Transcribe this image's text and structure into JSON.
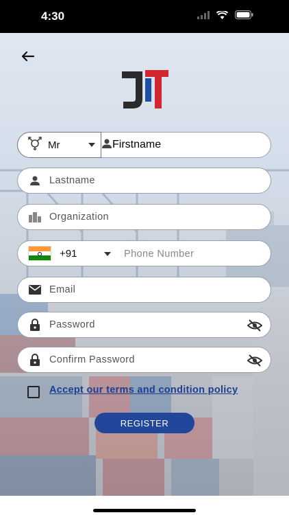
{
  "status_bar": {
    "time": "4:30"
  },
  "form": {
    "title_value": "Mr",
    "firstname_placeholder": "Firstname",
    "lastname_placeholder": "Lastname",
    "organization_placeholder": "Organization",
    "country_code": "+91",
    "phone_placeholder": "Phone Number",
    "email_placeholder": "Email",
    "password_placeholder": "Password",
    "confirm_password_placeholder": "Confirm Password",
    "terms_text": "Accept our terms and condition policy",
    "register_label": "REGISTER"
  },
  "icons": {
    "back": "arrow-left-icon",
    "gender": "gender-icon",
    "person": "person-icon",
    "building": "building-icon",
    "flag": "india-flag-icon",
    "email": "envelope-icon",
    "lock": "lock-icon",
    "visibility": "eye-off-icon"
  },
  "colors": {
    "primary": "#21469a",
    "link": "#1b3f90",
    "logo_dark": "#2b2b2b",
    "logo_red": "#d22630",
    "logo_blue": "#1f4fa3"
  }
}
